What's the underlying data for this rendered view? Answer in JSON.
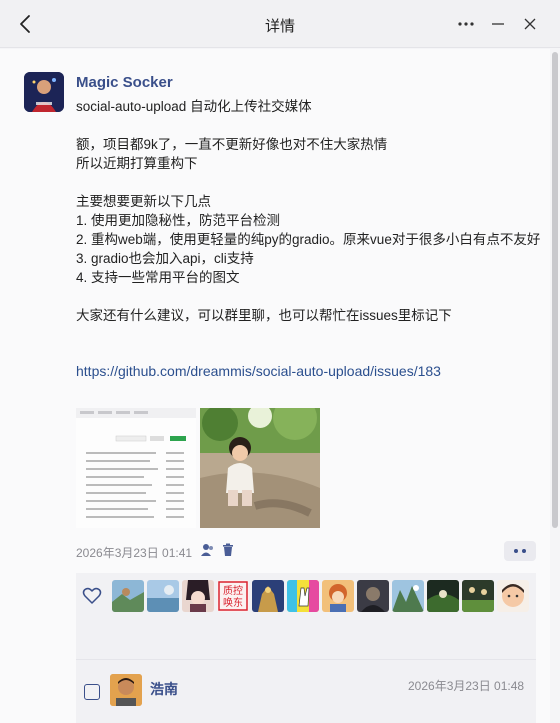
{
  "window": {
    "title": "详情"
  },
  "post": {
    "author": "Magic Socker",
    "lines": [
      "social-auto-upload 自动化上传社交媒体",
      "",
      "额，项目都9k了，一直不更新好像也对不住大家热情",
      "所以近期打算重构下",
      "",
      "主要想要更新以下几点",
      "1. 使用更加隐秘性，防范平台检测",
      "2. 重构web端，使用更轻量的纯py的gradio。原来vue对于很多小白有点不友好",
      "3. gradio也会加入api，cli支持",
      "4. 支持一些常用平台的图文",
      "",
      "大家还有什么建议，可以群里聊，也可以帮忙在issues里标记下"
    ],
    "link": "https://github.com/dreammis/social-auto-upload/issues/183",
    "timestamp": "2026年3月23日 01:41"
  },
  "likes": {
    "count_shown": 12,
    "avatar_text_2": "质控\n唤东"
  },
  "comment": {
    "name": "浩南",
    "time": "2026年3月23日 01:48"
  },
  "colors": {
    "accent": "#3a4f8a",
    "link": "#2b4f8e",
    "meta": "#8a8a90"
  }
}
